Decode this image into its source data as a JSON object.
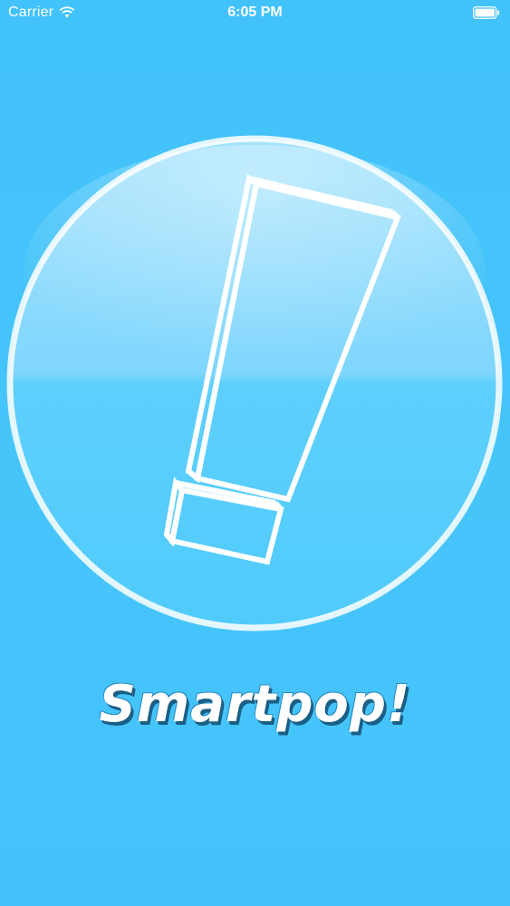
{
  "status_bar": {
    "carrier": "Carrier",
    "time": "6:05 PM",
    "icons": [
      "wifi-icon",
      "battery-icon"
    ]
  },
  "splash": {
    "app_name": "Smartpop!",
    "logo_icon": "exclamation-mark-icon"
  },
  "colors": {
    "background": "#45c4fb",
    "circle_fill_top": "#9fe0fd",
    "circle_fill_bottom": "#55cdfc",
    "outline": "#ffffff",
    "wordmark_shadow": "#1a5f86"
  }
}
